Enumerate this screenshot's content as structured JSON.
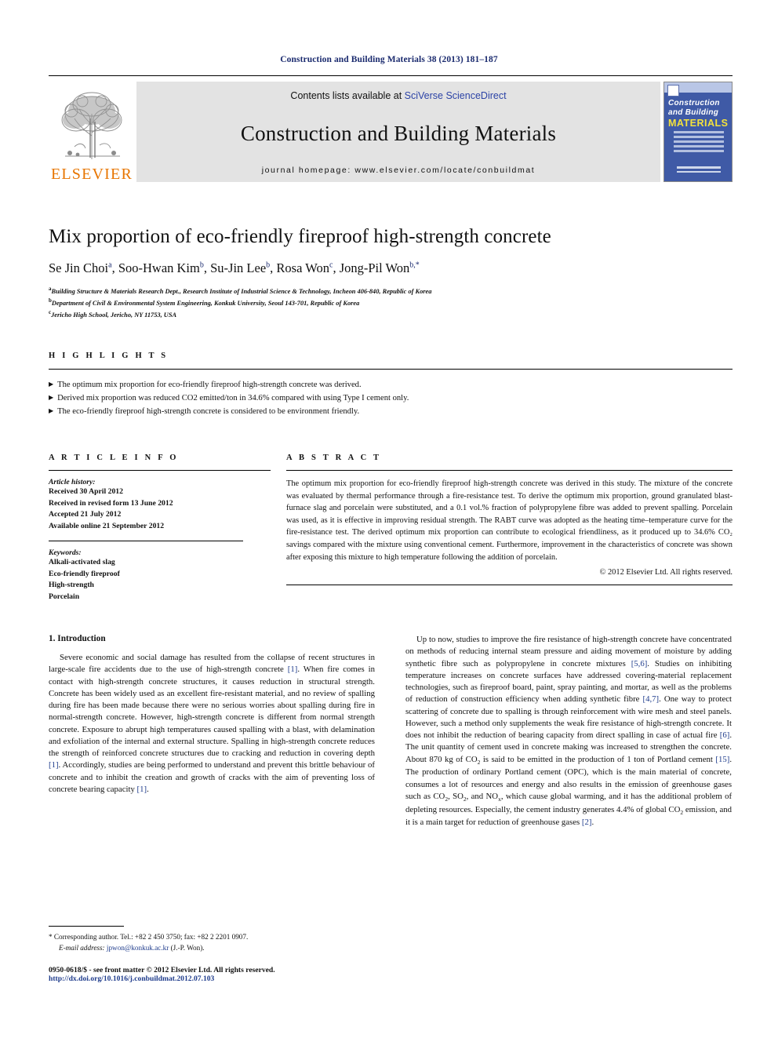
{
  "running_head": "Construction and Building Materials 38 (2013) 181–187",
  "masthead": {
    "contents_prefix": "Contents lists available at ",
    "sciencedirect": "SciVerse ScienceDirect",
    "journal_name": "Construction and Building Materials",
    "homepage": "journal homepage: www.elsevier.com/locate/conbuildmat",
    "publisher_logo_text": "ELSEVIER",
    "cover": {
      "line1": "Construction",
      "line2": "and Building",
      "line3": "MATERIALS"
    },
    "colors": {
      "running_head": "#1a2a6e",
      "link": "#2c43a6",
      "banner_bg": "#e3e3e3",
      "elsevier_orange": "#E77500",
      "cover_blue": "#3f5aa6",
      "cover_yellow": "#f4e23c"
    }
  },
  "article": {
    "title": "Mix proportion of eco-friendly fireproof high-strength concrete",
    "authors": [
      {
        "name": "Se Jin Choi",
        "sup": "a"
      },
      {
        "name": "Soo-Hwan Kim",
        "sup": "b"
      },
      {
        "name": "Su-Jin Lee",
        "sup": "b"
      },
      {
        "name": "Rosa Won",
        "sup": "c"
      },
      {
        "name": "Jong-Pil Won",
        "sup": "b,*"
      }
    ],
    "affiliations": [
      {
        "sup": "a",
        "text": "Building Structure & Materials Research Dept., Research Institute of Industrial Science & Technology, Incheon 406-840, Republic of Korea"
      },
      {
        "sup": "b",
        "text": "Department of Civil & Environmental System Engineering, Konkuk University, Seoul 143-701, Republic of Korea"
      },
      {
        "sup": "c",
        "text": "Jericho High School, Jericho, NY 11753, USA"
      }
    ]
  },
  "highlights": {
    "heading": "H I G H L I G H T S",
    "bullet_glyph": "▶",
    "items": [
      "The optimum mix proportion for eco-friendly fireproof high-strength concrete was derived.",
      "Derived mix proportion was reduced CO2 emitted/ton in 34.6% compared with using Type I cement only.",
      "The eco-friendly fireproof high-strength concrete is considered to be environment friendly."
    ]
  },
  "article_info": {
    "heading": "A R T I C L E    I N F O",
    "history_label": "Article history:",
    "history": [
      "Received 30 April 2012",
      "Received in revised form 13 June 2012",
      "Accepted 21 July 2012",
      "Available online 21 September 2012"
    ],
    "keywords_label": "Keywords:",
    "keywords": [
      "Alkali-activated slag",
      "Eco-friendly fireproof",
      "High-strength",
      "Porcelain"
    ]
  },
  "abstract": {
    "heading": "A B S T R A C T",
    "text": "The optimum mix proportion for eco-friendly fireproof high-strength concrete was derived in this study. The mixture of the concrete was evaluated by thermal performance through a fire-resistance test. To derive the optimum mix proportion, ground granulated blast-furnace slag and porcelain were substituted, and a 0.1 vol.% fraction of polypropylene fibre was added to prevent spalling. Porcelain was used, as it is effective in improving residual strength. The RABT curve was adopted as the heating time–temperature curve for the fire-resistance test. The derived optimum mix proportion can contribute to ecological friendliness, as it produced up to 34.6% CO₂ savings compared with the mixture using conventional cement. Furthermore, improvement in the characteristics of concrete was shown after exposing this mixture to high temperature following the addition of porcelain.",
    "copyright": "© 2012 Elsevier Ltd. All rights reserved."
  },
  "body": {
    "section_heading": "1. Introduction",
    "left_paragraph_html": "Severe economic and social damage has resulted from the collapse of recent structures in large-scale fire accidents due to the use of high-strength concrete <span class=\"cite\">[1]</span>. When fire comes in contact with high-strength concrete structures, it causes reduction in structural strength. Concrete has been widely used as an excellent fire-resistant material, and no review of spalling during fire has been made because there were no serious worries about spalling during fire in normal-strength concrete. However, high-strength concrete is different from normal strength concrete. Exposure to abrupt high temperatures caused spalling with a blast, with delamination and exfoliation of the internal and external structure. Spalling in high-strength concrete reduces the strength of reinforced concrete structures due to cracking and reduction in covering depth <span class=\"cite\">[1]</span>. Accordingly, studies are being performed to understand and prevent this brittle behaviour of concrete and to inhibit the creation and growth of cracks with the aim of preventing loss of concrete bearing capacity <span class=\"cite\">[1]</span>.",
    "right_paragraph_html": "Up to now, studies to improve the fire resistance of high-strength concrete have concentrated on methods of reducing internal steam pressure and aiding movement of moisture by adding synthetic fibre such as polypropylene in concrete mixtures <span class=\"cite\">[5,6]</span>. Studies on inhibiting temperature increases on concrete surfaces have addressed covering-material replacement technologies, such as fireproof board, paint, spray painting, and mortar, as well as the problems of reduction of construction efficiency when adding synthetic fibre <span class=\"cite\">[4,7]</span>. One way to protect scattering of concrete due to spalling is through reinforcement with wire mesh and steel panels. However, such a method only supplements the weak fire resistance of high-strength concrete. It does not inhibit the reduction of bearing capacity from direct spalling in case of actual fire <span class=\"cite\">[6]</span>. The unit quantity of cement used in concrete making was increased to strengthen the concrete. About 870 kg of CO<sub>2</sub> is said to be emitted in the production of 1 ton of Portland cement <span class=\"cite\">[15]</span>. The production of ordinary Portland cement (OPC), which is the main material of concrete, consumes a lot of resources and energy and also results in the emission of greenhouse gases such as CO<sub>2</sub>, SO<sub>2</sub>, and NO<sub>x</sub>, which cause global warming, and it has the additional problem of depleting resources. Especially, the cement industry generates 4.4% of global CO<sub>2</sub> emission, and it is a main target for reduction of greenhouse gases <span class=\"cite\">[2]</span>."
  },
  "footer": {
    "corresponding_marker": "*",
    "corresponding_text": "Corresponding author. Tel.: +82 2 450 3750; fax: +82 2 2201 0907.",
    "email_label": "E-mail address:",
    "email": "jpwon@konkuk.ac.kr",
    "email_owner": "(J.-P. Won).",
    "issn_line": "0950-0618/$ - see front matter © 2012 Elsevier Ltd. All rights reserved.",
    "doi_line": "http://dx.doi.org/10.1016/j.conbuildmat.2012.07.103"
  }
}
